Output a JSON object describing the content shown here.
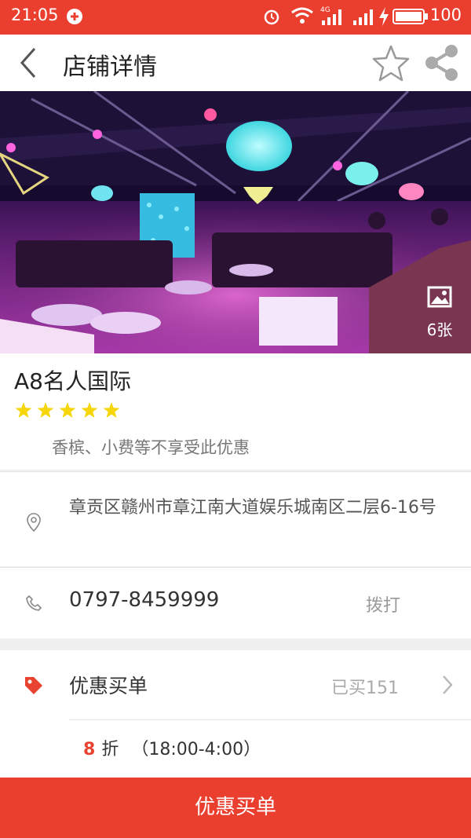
{
  "status_bar": {
    "time": "21:05",
    "network": "4G",
    "battery": "100"
  },
  "header": {
    "title": "店铺详情"
  },
  "gallery": {
    "photo_count": "6张"
  },
  "store": {
    "name": "A8名人国际",
    "rating": 5,
    "note": "香槟、小费等不享受此优惠"
  },
  "address": {
    "text": "章贡区赣州市章江南大道娱乐城南区二层6-16号"
  },
  "phone": {
    "number": "0797-8459999",
    "dial_label": "拨打"
  },
  "discount": {
    "label": "优惠买单",
    "bought": "已买151",
    "rate": "8",
    "unit": "折",
    "hours": "（18:00-4:00）"
  },
  "cta": {
    "label": "优惠买单"
  },
  "colors": {
    "brand_red": "#ea3f2f",
    "star_yellow": "#f5d60a"
  },
  "icons": [
    "back-arrow-icon",
    "star-outline-icon",
    "share-icon",
    "image-icon",
    "location-pin-icon",
    "phone-icon",
    "tag-icon",
    "chevron-right-icon"
  ]
}
